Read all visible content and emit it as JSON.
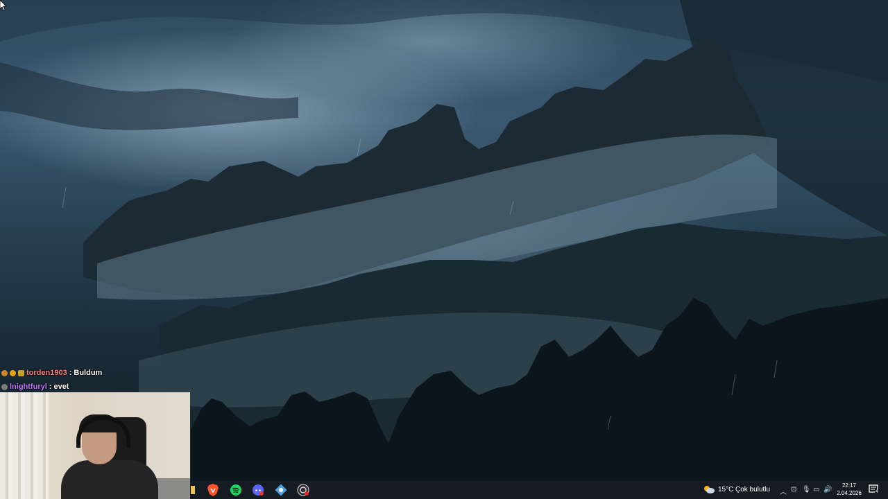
{
  "chat": {
    "messages": [
      {
        "user": "torden1903",
        "separator": ":",
        "text": "Buldum",
        "user_color": "#ff7f7f"
      },
      {
        "user": "lnightfuryl",
        "separator": ":",
        "text": "evet",
        "user_color": "#c873ff"
      }
    ]
  },
  "taskbar": {
    "apps": [
      "file-explorer-icon",
      "brave-browser-icon",
      "spotify-icon",
      "discord-icon",
      "app-icon",
      "obs-icon"
    ],
    "weather": {
      "temperature": "15°C",
      "condition": "Çok bulutlu"
    },
    "clock": {
      "time": "22:17",
      "date": "2.04.2026"
    },
    "notification_count": "4"
  }
}
